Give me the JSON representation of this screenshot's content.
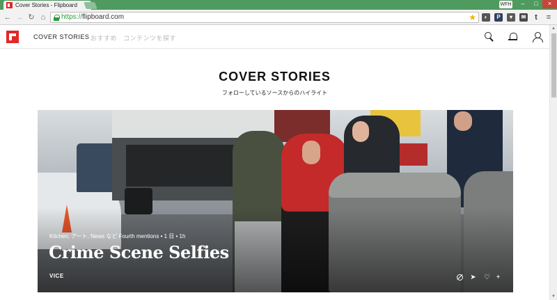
{
  "browser": {
    "tab_title": "Cover Stories - Flipboard",
    "profile_label": "WFH",
    "url_scheme": "https://",
    "url_host": "flipboard.com",
    "icons": {
      "back": "back-arrow-icon",
      "forward": "forward-arrow-icon",
      "reload": "reload-icon",
      "home": "home-icon",
      "bookmark": "star-icon"
    }
  },
  "site": {
    "brand_color": "#e12828",
    "nav": {
      "cover_stories": "COVER STORIES",
      "for_you": "おすすめ",
      "content": "コンテンツを探す"
    }
  },
  "page": {
    "title": "COVER STORIES",
    "subtitle": "フォローしているソースからのハイライト"
  },
  "hero": {
    "meta": "Kitchen, アート, News など Fourth mentions • 1 日 • 1h",
    "title": "Crime Scene Selfies",
    "source": "VICE"
  }
}
